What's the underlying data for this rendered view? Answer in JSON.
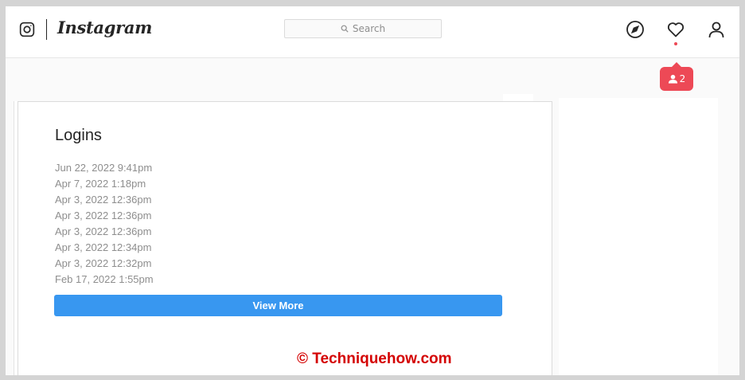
{
  "header": {
    "brand": "Instagram",
    "search": {
      "placeholder": "Search"
    },
    "icons": [
      "instagram-glyph-icon",
      "compass-icon",
      "heart-icon",
      "user-icon"
    ],
    "notification": {
      "count": "2"
    }
  },
  "logins": {
    "title": "Logins",
    "entries": [
      "Jun 22, 2022 9:41pm",
      "Apr 7, 2022 1:18pm",
      "Apr 3, 2022 12:36pm",
      "Apr 3, 2022 12:36pm",
      "Apr 3, 2022 12:36pm",
      "Apr 3, 2022 12:34pm",
      "Apr 3, 2022 12:32pm",
      "Feb 17, 2022 1:55pm"
    ],
    "view_more_label": "View More"
  },
  "watermark": "© Techniquehow.com",
  "colors": {
    "button": "#3897f0",
    "notification": "#ed4956",
    "watermark": "#d40000"
  }
}
